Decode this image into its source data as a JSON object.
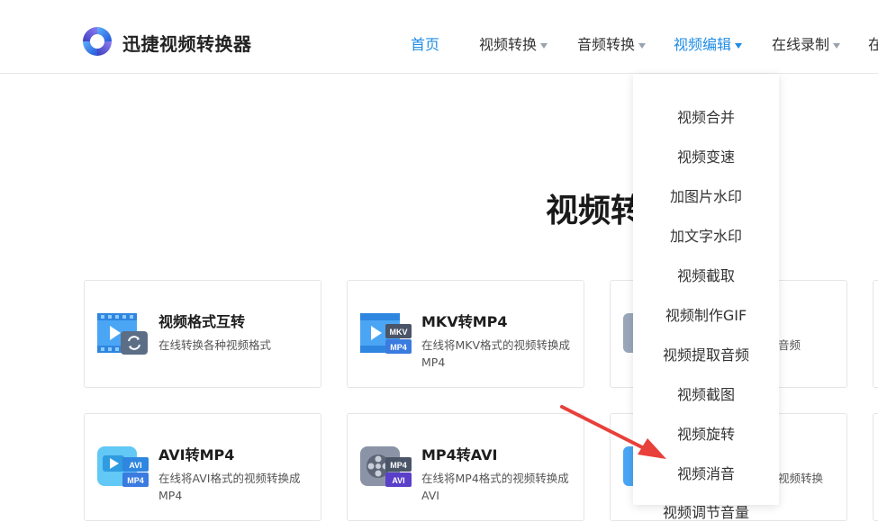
{
  "header": {
    "brand": "迅捷视频转换器",
    "nav": [
      {
        "label": "首页",
        "state": "home"
      },
      {
        "label": "视频转换",
        "state": "normal"
      },
      {
        "label": "音频转换",
        "state": "normal"
      },
      {
        "label": "视频编辑",
        "state": "active"
      },
      {
        "label": "在线录制",
        "state": "normal"
      },
      {
        "label": "在",
        "state": "cut"
      }
    ]
  },
  "main": {
    "heading": "视频转"
  },
  "cards": [
    {
      "title": "视频格式互转",
      "desc": "在线转换各种视频格式",
      "icon": "video-convert-icon"
    },
    {
      "title": "MKV转MP4",
      "desc": "在线将MKV格式的视频转换成MP4",
      "icon": "mkv-to-mp4-icon",
      "badges": [
        "MKV",
        "MP4"
      ]
    },
    {
      "title": "",
      "desc": "音频",
      "icon": "audio-icon"
    },
    {
      "title": "AVI转MP4",
      "desc": "在线将AVI格式的视频转换成MP4",
      "icon": "avi-to-mp4-icon",
      "badges": [
        "AVI",
        "MP4"
      ]
    },
    {
      "title": "MP4转AVI",
      "desc": "在线将MP4格式的视频转换成AVI",
      "icon": "mp4-to-avi-icon",
      "badges": [
        "MP4",
        "AVI"
      ]
    },
    {
      "title": "",
      "desc": "视频转换",
      "icon": "video-icon"
    }
  ],
  "dropdown": {
    "items": [
      "视频合并",
      "视频变速",
      "加图片水印",
      "加文字水印",
      "视频截取",
      "视频制作GIF",
      "视频提取音频",
      "视频截图",
      "视频旋转",
      "视频消音",
      "视频调节音量"
    ]
  },
  "colors": {
    "accent": "#1f8ce6",
    "arrow": "#e8403a"
  }
}
